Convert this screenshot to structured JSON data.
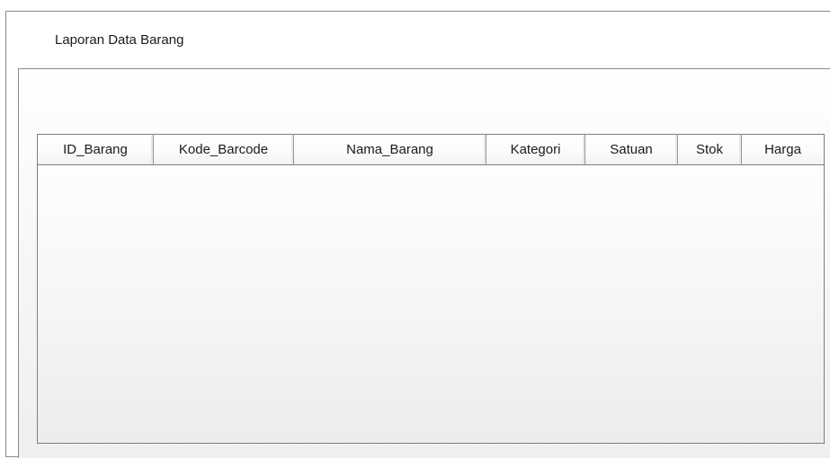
{
  "window": {
    "title": "Laporan Data Barang"
  },
  "table": {
    "columns": [
      {
        "label": "ID_Barang"
      },
      {
        "label": "Kode_Barcode"
      },
      {
        "label": "Nama_Barang"
      },
      {
        "label": "Kategori"
      },
      {
        "label": "Satuan"
      },
      {
        "label": "Stok"
      },
      {
        "label": "Harga"
      }
    ],
    "rows": []
  }
}
